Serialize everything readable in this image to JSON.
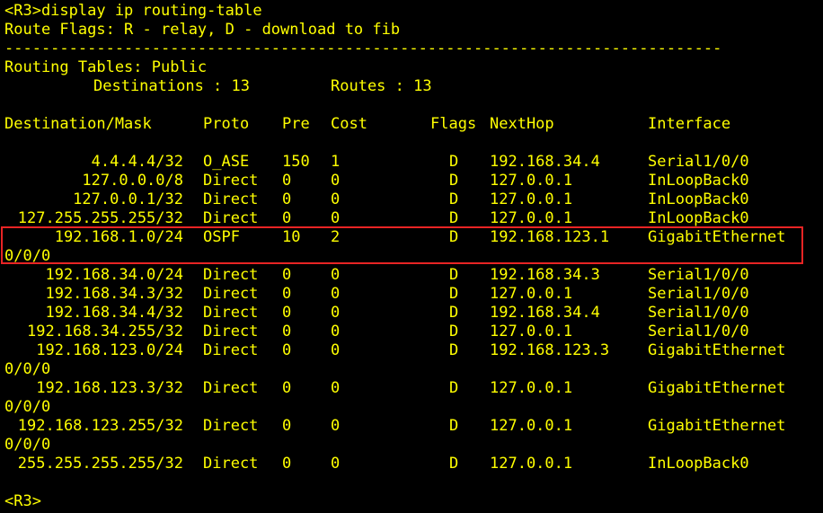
{
  "command_line": "<R3>display ip routing-table",
  "flags_legend": "Route Flags: R - relay, D - download to fib",
  "separator": "------------------------------------------------------------------------------",
  "table_title": "Routing Tables: Public",
  "summary": {
    "destinations_label": "Destinations : 13",
    "routes_label": "Routes : 13"
  },
  "headers": {
    "destination": "Destination/Mask",
    "proto": "Proto",
    "pre": "Pre",
    "cost": "Cost",
    "flags": "Flags",
    "nexthop": "NextHop",
    "interface": "Interface"
  },
  "routes": [
    {
      "dest": "4.4.4.4/32",
      "proto": "O_ASE",
      "pre": "150",
      "cost": "1",
      "flags": "D",
      "nexthop": "192.168.34.4",
      "iface": "Serial1/0/0",
      "iface_cont": ""
    },
    {
      "dest": "127.0.0.0/8",
      "proto": "Direct",
      "pre": "0",
      "cost": "0",
      "flags": "D",
      "nexthop": "127.0.0.1",
      "iface": "InLoopBack0",
      "iface_cont": ""
    },
    {
      "dest": "127.0.0.1/32",
      "proto": "Direct",
      "pre": "0",
      "cost": "0",
      "flags": "D",
      "nexthop": "127.0.0.1",
      "iface": "InLoopBack0",
      "iface_cont": ""
    },
    {
      "dest": "127.255.255.255/32",
      "proto": "Direct",
      "pre": "0",
      "cost": "0",
      "flags": "D",
      "nexthop": "127.0.0.1",
      "iface": "InLoopBack0",
      "iface_cont": ""
    },
    {
      "dest": "192.168.1.0/24",
      "proto": "OSPF",
      "pre": "10",
      "cost": "2",
      "flags": "D",
      "nexthop": "192.168.123.1",
      "iface": "GigabitEthernet",
      "iface_cont": "0/0/0"
    },
    {
      "dest": "192.168.34.0/24",
      "proto": "Direct",
      "pre": "0",
      "cost": "0",
      "flags": "D",
      "nexthop": "192.168.34.3",
      "iface": "Serial1/0/0",
      "iface_cont": ""
    },
    {
      "dest": "192.168.34.3/32",
      "proto": "Direct",
      "pre": "0",
      "cost": "0",
      "flags": "D",
      "nexthop": "127.0.0.1",
      "iface": "Serial1/0/0",
      "iface_cont": ""
    },
    {
      "dest": "192.168.34.4/32",
      "proto": "Direct",
      "pre": "0",
      "cost": "0",
      "flags": "D",
      "nexthop": "192.168.34.4",
      "iface": "Serial1/0/0",
      "iface_cont": ""
    },
    {
      "dest": "192.168.34.255/32",
      "proto": "Direct",
      "pre": "0",
      "cost": "0",
      "flags": "D",
      "nexthop": "127.0.0.1",
      "iface": "Serial1/0/0",
      "iface_cont": ""
    },
    {
      "dest": "192.168.123.0/24",
      "proto": "Direct",
      "pre": "0",
      "cost": "0",
      "flags": "D",
      "nexthop": "192.168.123.3",
      "iface": "GigabitEthernet",
      "iface_cont": "0/0/0"
    },
    {
      "dest": "192.168.123.3/32",
      "proto": "Direct",
      "pre": "0",
      "cost": "0",
      "flags": "D",
      "nexthop": "127.0.0.1",
      "iface": "GigabitEthernet",
      "iface_cont": "0/0/0"
    },
    {
      "dest": "192.168.123.255/32",
      "proto": "Direct",
      "pre": "0",
      "cost": "0",
      "flags": "D",
      "nexthop": "127.0.0.1",
      "iface": "GigabitEthernet",
      "iface_cont": "0/0/0"
    },
    {
      "dest": "255.255.255.255/32",
      "proto": "Direct",
      "pre": "0",
      "cost": "0",
      "flags": "D",
      "nexthop": "127.0.0.1",
      "iface": "InLoopBack0",
      "iface_cont": ""
    }
  ],
  "final_prompt": "<R3>",
  "colors": {
    "background": "#000000",
    "text": "#ffff00",
    "highlight": "#e82424"
  }
}
